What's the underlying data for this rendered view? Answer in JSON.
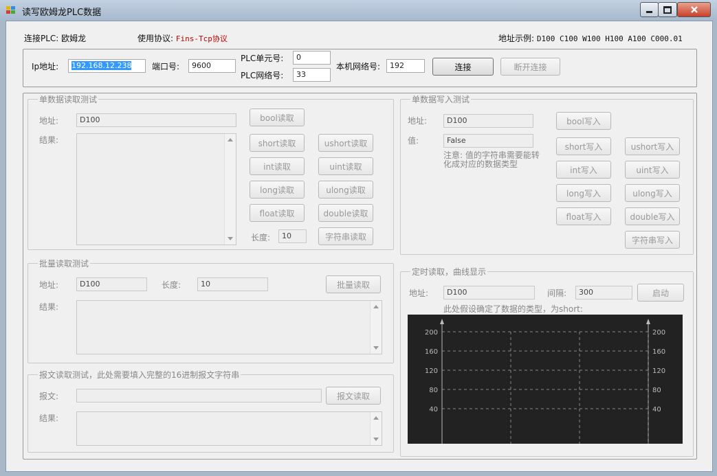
{
  "window": {
    "title": "读写欧姆龙PLC数据"
  },
  "info": {
    "plc_label": "连接PLC: 欧姆龙",
    "protocol_label": "使用协议: ",
    "protocol_value": "Fins-Tcp协议",
    "addr_example_label": "地址示例: ",
    "addr_example_value": "D100 C100 W100 H100 A100 C000.01"
  },
  "connection": {
    "ip_label": "Ip地址:",
    "ip_value": "192.168.12.238",
    "port_label": "端口号:",
    "port_value": "9600",
    "unit_label": "PLC单元号:",
    "unit_value": "0",
    "net_label": "PLC网络号:",
    "net_value": "33",
    "local_net_label": "本机网络号:",
    "local_net_value": "192",
    "connect_button": "连接",
    "disconnect_button": "断开连接"
  },
  "single_read": {
    "title": "单数据读取测试",
    "addr_label": "地址:",
    "addr_value": "D100",
    "result_label": "结果:",
    "bool": "bool读取",
    "short": "short读取",
    "ushort": "ushort读取",
    "int": "int读取",
    "uint": "uint读取",
    "long": "long读取",
    "ulong": "ulong读取",
    "float": "float读取",
    "double": "double读取",
    "length_label": "长度:",
    "length_value": "10",
    "string": "字符串读取"
  },
  "single_write": {
    "title": "单数据写入测试",
    "addr_label": "地址:",
    "addr_value": "D100",
    "value_label": "值:",
    "value_value": "False",
    "note": "注意: 值的字符串需要能转化成对应的数据类型",
    "bool": "bool写入",
    "short": "short写入",
    "ushort": "ushort写入",
    "int": "int写入",
    "uint": "uint写入",
    "long": "long写入",
    "ulong": "ulong写入",
    "float": "float写入",
    "double": "double写入",
    "string": "字符串写入"
  },
  "batch_read": {
    "title": "批量读取测试",
    "addr_label": "地址:",
    "addr_value": "D100",
    "length_label": "长度:",
    "length_value": "10",
    "button": "批量读取",
    "result_label": "结果:"
  },
  "message_read": {
    "title": "报文读取测试，此处需要填入完整的16进制报文字符串",
    "msg_label": "报文:",
    "msg_value": "",
    "button": "报文读取",
    "result_label": "结果:"
  },
  "timed_read": {
    "title": "定时读取，曲线显示",
    "addr_label": "地址:",
    "addr_value": "D100",
    "interval_label": "间隔:",
    "interval_value": "300",
    "start_button": "启动",
    "note": "此处假设确定了数据的类型，为short:"
  },
  "chart_data": {
    "type": "line",
    "y_ticks": [
      "200",
      "160",
      "120",
      "80",
      "40"
    ],
    "ylim": [
      0,
      200
    ],
    "grid": true,
    "series": [],
    "colors": {
      "background": "#222222",
      "grid": "#8a8a8a",
      "text": "#bbbbbb"
    }
  }
}
